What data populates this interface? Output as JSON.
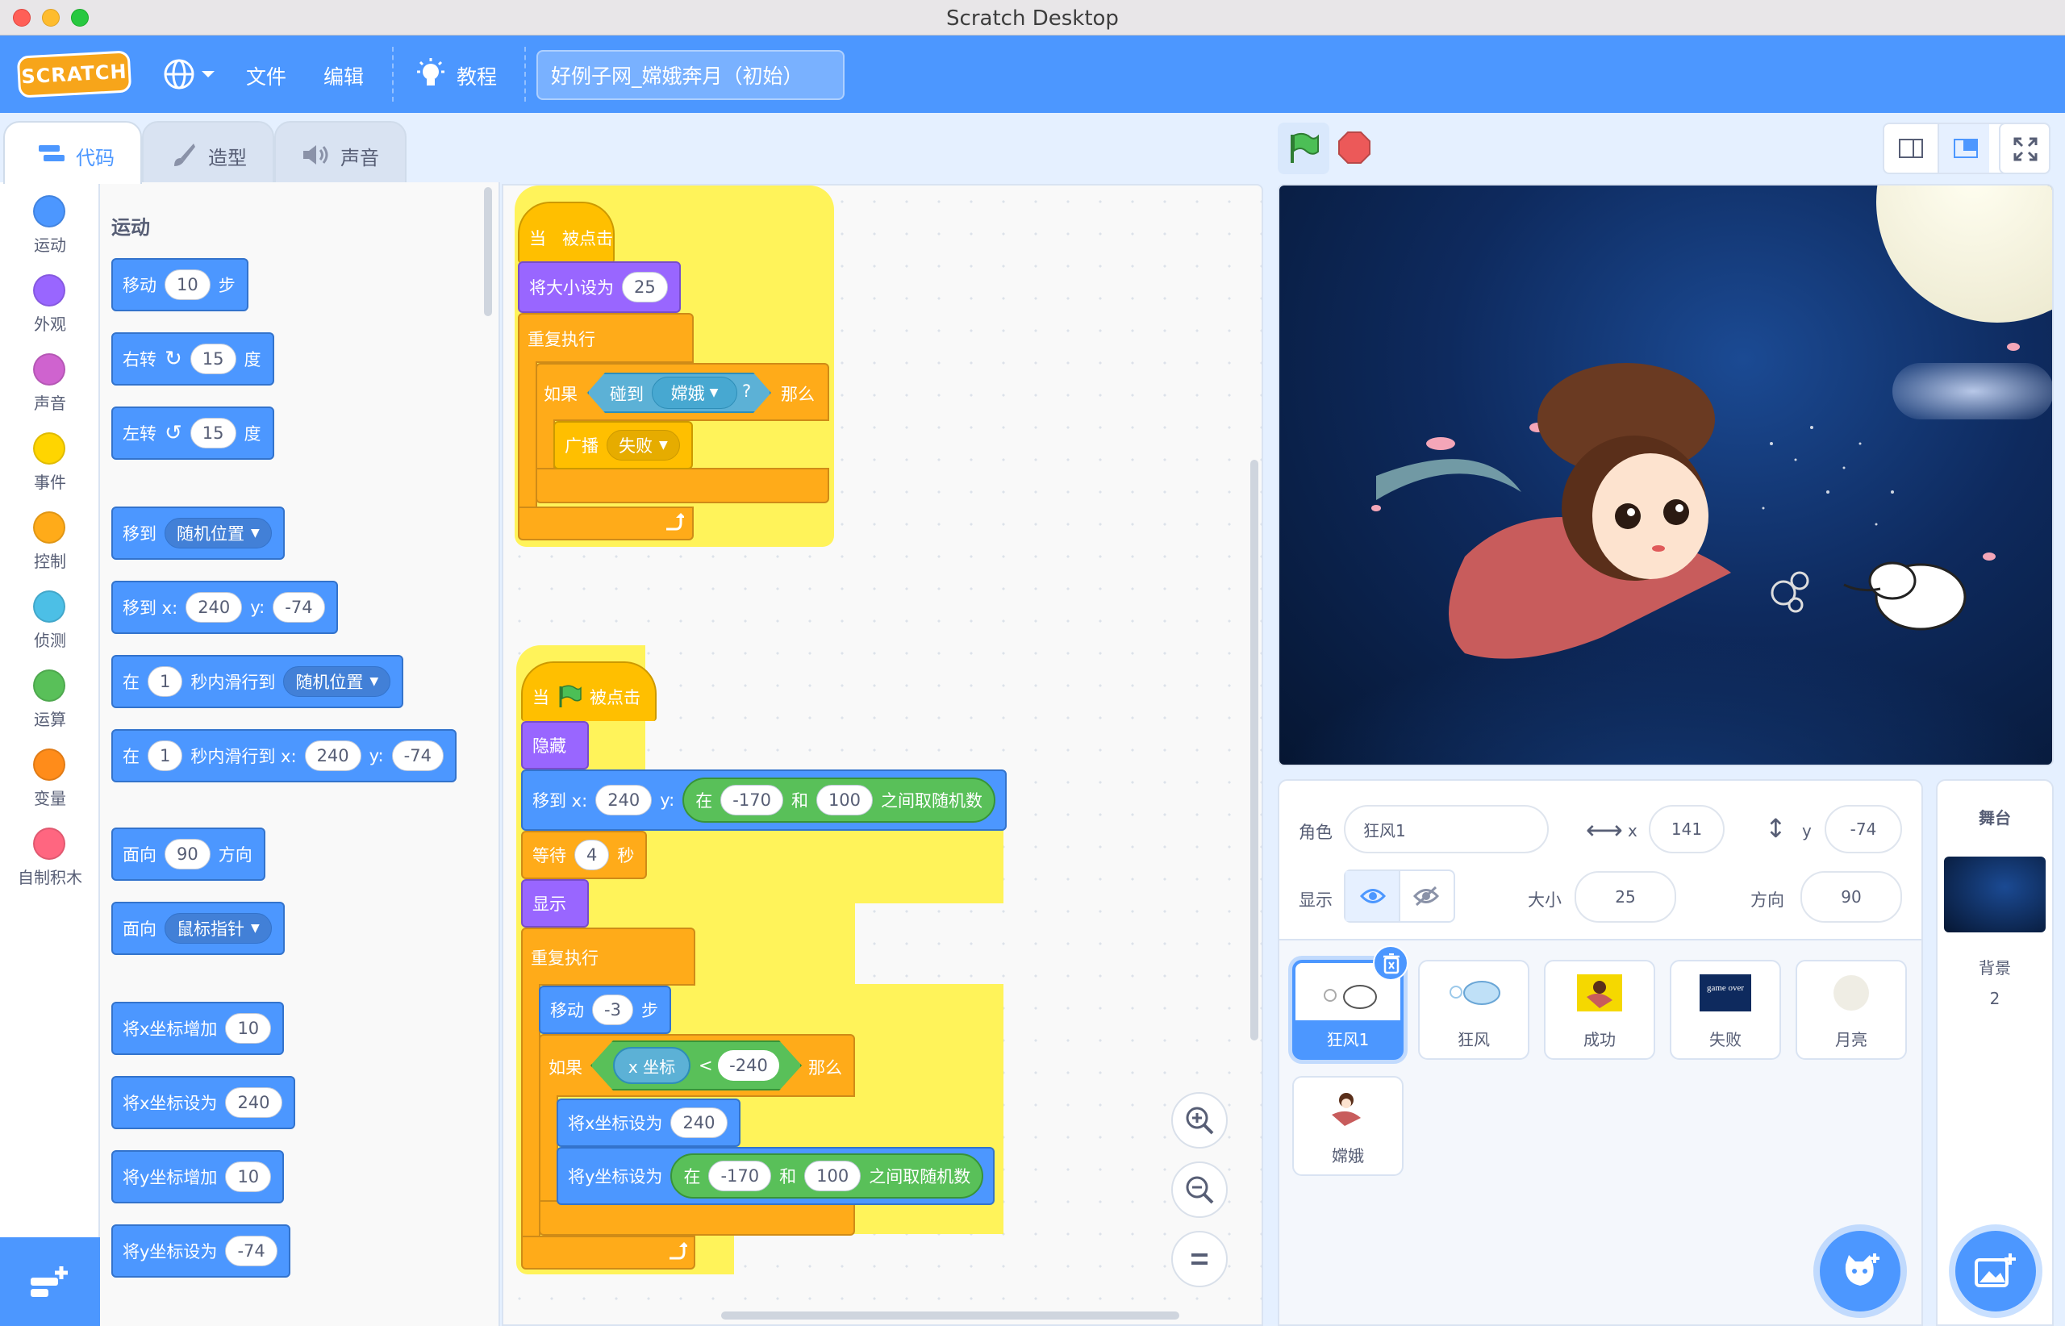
{
  "window": {
    "title": "Scratch Desktop"
  },
  "menu": {
    "logo": "SCRATCH",
    "file": "文件",
    "edit": "编辑",
    "tutorial": "教程",
    "project_title": "好例子网_嫦娥奔月（初始）"
  },
  "tabs": {
    "code": "代码",
    "costumes": "造型",
    "sounds": "声音"
  },
  "categories": [
    {
      "label": "运动",
      "color": "#4c97ff"
    },
    {
      "label": "外观",
      "color": "#9966ff"
    },
    {
      "label": "声音",
      "color": "#cf63cf"
    },
    {
      "label": "事件",
      "color": "#ffd500"
    },
    {
      "label": "控制",
      "color": "#ffab19"
    },
    {
      "label": "侦测",
      "color": "#4cbfe6"
    },
    {
      "label": "运算",
      "color": "#59c059"
    },
    {
      "label": "变量",
      "color": "#ff8c1a"
    },
    {
      "label": "自制积木",
      "color": "#ff6680"
    }
  ],
  "palette": {
    "heading": "运动",
    "move": {
      "a": "移动",
      "v": "10",
      "b": "步"
    },
    "turn_right": {
      "a": "右转",
      "v": "15",
      "b": "度"
    },
    "turn_left": {
      "a": "左转",
      "v": "15",
      "b": "度"
    },
    "goto": {
      "a": "移到",
      "dd": "随机位置"
    },
    "goto_xy": {
      "a": "移到 x:",
      "x": "240",
      "y_label": "y:",
      "y": "-74"
    },
    "glide": {
      "a": "在",
      "v": "1",
      "b": "秒内滑行到",
      "dd": "随机位置"
    },
    "glide_xy": {
      "a": "在",
      "v": "1",
      "b": "秒内滑行到 x:",
      "x": "240",
      "y_label": "y:",
      "y": "-74"
    },
    "point_dir": {
      "a": "面向",
      "v": "90",
      "b": "方向"
    },
    "point_towards": {
      "a": "面向",
      "dd": "鼠标指针"
    },
    "change_x": {
      "a": "将x坐标增加",
      "v": "10"
    },
    "set_x": {
      "a": "将x坐标设为",
      "v": "240"
    },
    "change_y": {
      "a": "将y坐标增加",
      "v": "10"
    },
    "set_y": {
      "a": "将y坐标设为",
      "v": "-74"
    }
  },
  "script1": {
    "hat_a": "当",
    "hat_b": "被点击",
    "set_size": {
      "a": "将大小设为",
      "v": "25"
    },
    "forever": "重复执行",
    "if_a": "如果",
    "touching": "碰到",
    "touching_dd": "嫦娥",
    "q": "?",
    "then": "那么",
    "broadcast": "广播",
    "broadcast_dd": "失败"
  },
  "script2": {
    "hat_a": "当",
    "hat_b": "被点击",
    "hide": "隐藏",
    "goto": {
      "a": "移到 x:",
      "x": "240",
      "y_label": "y:",
      "in": "在",
      "from": "-170",
      "and": "和",
      "to": "100",
      "rand": "之间取随机数"
    },
    "wait": {
      "a": "等待",
      "v": "4",
      "b": "秒"
    },
    "show": "显示",
    "forever": "重复执行",
    "move": {
      "a": "移动",
      "v": "-3",
      "b": "步"
    },
    "if_a": "如果",
    "xpos": "x 坐标",
    "lt": "<",
    "cmp": "-240",
    "then": "那么",
    "set_x": {
      "a": "将x坐标设为",
      "v": "240"
    },
    "set_y": {
      "a": "将y坐标设为",
      "in": "在",
      "from": "-170",
      "and": "和",
      "to": "100",
      "rand": "之间取随机数"
    }
  },
  "sprite_info": {
    "sprite_label": "角色",
    "sprite_name": "狂风1",
    "x_label": "x",
    "x": "141",
    "y_label": "y",
    "y": "-74",
    "show_label": "显示",
    "size_label": "大小",
    "size": "25",
    "direction_label": "方向",
    "direction": "90"
  },
  "sprites": [
    {
      "name": "狂风1",
      "selected": true
    },
    {
      "name": "狂风",
      "selected": false
    },
    {
      "name": "成功",
      "selected": false
    },
    {
      "name": "失败",
      "selected": false
    },
    {
      "name": "月亮",
      "selected": false
    },
    {
      "name": "嫦娥",
      "selected": false
    }
  ],
  "stage_panel": {
    "title": "舞台",
    "backdrops_label": "背景",
    "backdrops_count": "2"
  },
  "thumb_text": {
    "fail": "game over"
  },
  "colors": {
    "accent": "#4c97ff",
    "selected_sprite": "#4c97ff",
    "glow": "#fff35a"
  }
}
